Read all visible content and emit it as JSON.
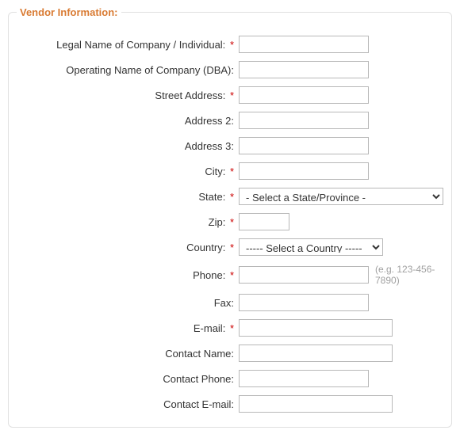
{
  "section_title": "Vendor Information:",
  "labels": {
    "legal_name": "Legal Name of Company / Individual:",
    "operating_name": "Operating Name of Company (DBA):",
    "street": "Street Address:",
    "address2": "Address 2:",
    "address3": "Address 3:",
    "city": "City:",
    "state": "State:",
    "zip": "Zip:",
    "country": "Country:",
    "phone": "Phone:",
    "fax": "Fax:",
    "email": "E-mail:",
    "contact_name": "Contact Name:",
    "contact_phone": "Contact Phone:",
    "contact_email": "Contact E-mail:"
  },
  "required_marker": "*",
  "values": {
    "legal_name": "",
    "operating_name": "",
    "street": "",
    "address2": "",
    "address3": "",
    "city": "",
    "state": "- Select a State/Province -",
    "zip": "",
    "country": "----- Select a Country -----",
    "phone": "",
    "fax": "",
    "email": "",
    "contact_name": "",
    "contact_phone": "",
    "contact_email": ""
  },
  "hints": {
    "phone": "(e.g. 123-456-7890)"
  },
  "options": {
    "state": [
      "- Select a State/Province -"
    ],
    "country": [
      "----- Select a Country -----"
    ]
  }
}
